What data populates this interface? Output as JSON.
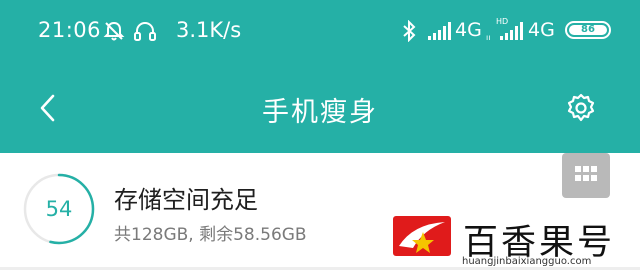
{
  "status_bar": {
    "time": "21:06",
    "net_speed": "3.1K/s",
    "network1": "4G",
    "network1_sub": "ıı",
    "hd_label": "HD",
    "network2": "4G",
    "battery": "86",
    "icons": [
      "mute-icon",
      "headset-icon",
      "bluetooth-icon",
      "signal-icon",
      "signal-icon",
      "battery-icon"
    ]
  },
  "header": {
    "title": "手机瘦身",
    "back_icon": "chevron-left-icon",
    "settings_icon": "gear-icon",
    "color": "#25b0a6"
  },
  "storage": {
    "score": "54",
    "status_title": "存储空间充足",
    "status_sub": "共128GB, 剩余58.56GB",
    "fill_fraction": 0.54,
    "menu_icon": "grid-icon"
  },
  "watermark": {
    "text": "百香果号",
    "url": "huangjinbaixiangguo.com"
  }
}
